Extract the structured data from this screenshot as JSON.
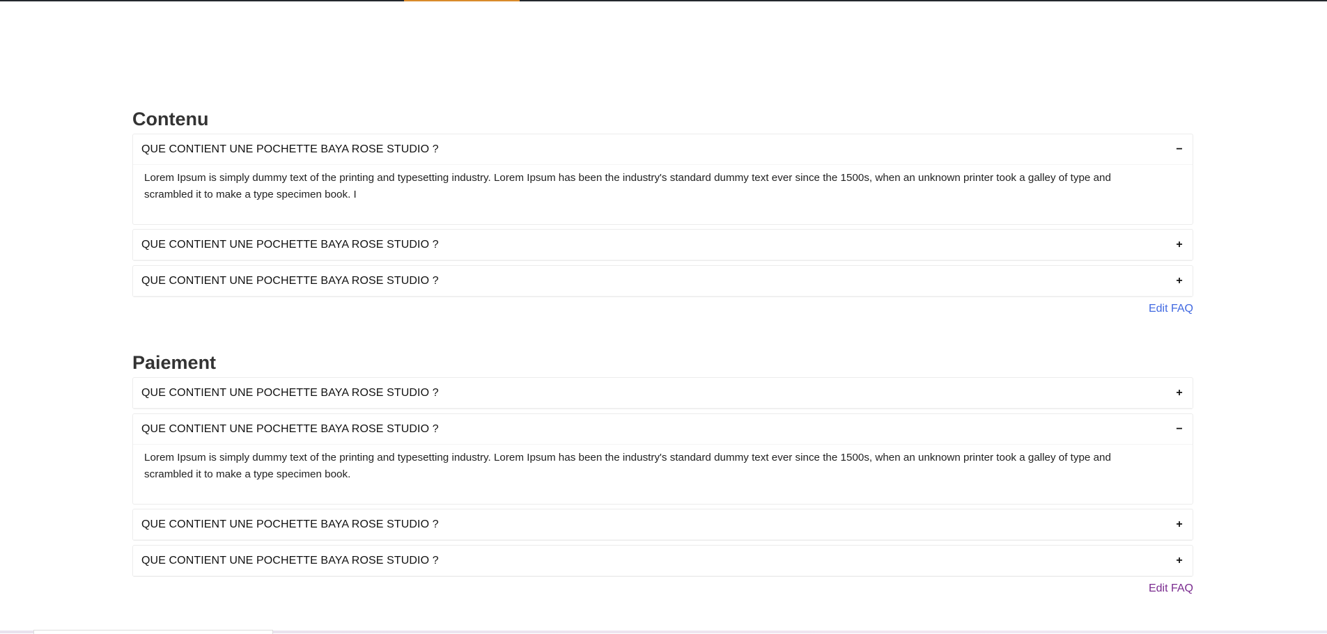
{
  "sections": [
    {
      "title": "Contenu",
      "items": [
        {
          "question": "QUE CONTIENT UNE POCHETTE BAYA ROSE STUDIO ?",
          "toggle": "−",
          "answer": "Lorem Ipsum is simply dummy text of the printing and typesetting industry. Lorem Ipsum has been the industry's standard dummy text ever since the 1500s, when an unknown printer took a galley of type and scrambled it to make a type specimen book. I"
        },
        {
          "question": "QUE CONTIENT UNE POCHETTE BAYA ROSE STUDIO ?",
          "toggle": "+"
        },
        {
          "question": "QUE CONTIENT UNE POCHETTE BAYA ROSE STUDIO ?",
          "toggle": "+"
        }
      ],
      "edit_label": "Edit FAQ"
    },
    {
      "title": "Paiement",
      "items": [
        {
          "question": "QUE CONTIENT UNE POCHETTE BAYA ROSE STUDIO ?",
          "toggle": "+"
        },
        {
          "question": "QUE CONTIENT UNE POCHETTE BAYA ROSE STUDIO ?",
          "toggle": "−",
          "answer": "Lorem Ipsum is simply dummy text of the printing and typesetting industry. Lorem Ipsum has been the industry's standard dummy text ever since the 1500s, when an unknown printer took a galley of type and scrambled it to make a type specimen book."
        },
        {
          "question": "QUE CONTIENT UNE POCHETTE BAYA ROSE STUDIO ?",
          "toggle": "+"
        },
        {
          "question": "QUE CONTIENT UNE POCHETTE BAYA ROSE STUDIO ?",
          "toggle": "+"
        }
      ],
      "edit_label": "Edit FAQ"
    }
  ],
  "colors": {
    "accent": "#d98b2b",
    "link": "#4169e1",
    "link_visited": "#7a2b8f"
  }
}
